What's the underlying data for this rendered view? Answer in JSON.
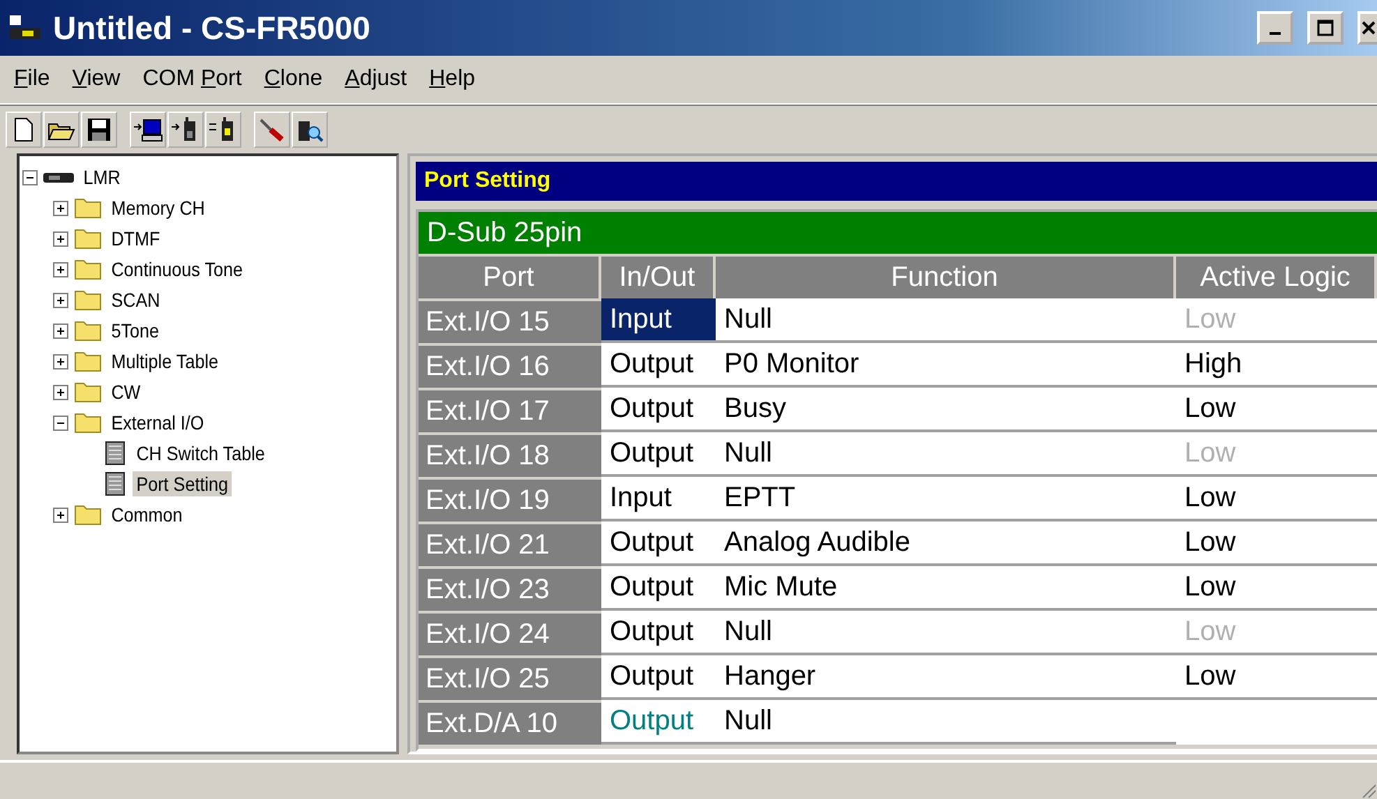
{
  "window": {
    "title": "Untitled - CS-FR5000"
  },
  "menu": [
    {
      "key": "F",
      "after": "ile"
    },
    {
      "key": "V",
      "after": "iew"
    },
    {
      "before": "COM ",
      "key": "P",
      "after": "ort"
    },
    {
      "key": "C",
      "after": "lone"
    },
    {
      "key": "A",
      "after": "djust"
    },
    {
      "key": "H",
      "after": "elp"
    }
  ],
  "toolbar": [
    {
      "kind": "new"
    },
    {
      "kind": "open"
    },
    {
      "kind": "save"
    },
    {
      "kind": "sep"
    },
    {
      "kind": "pc"
    },
    {
      "kind": "radio"
    },
    {
      "kind": "radio2"
    },
    {
      "kind": "sep"
    },
    {
      "kind": "tool"
    },
    {
      "kind": "find"
    }
  ],
  "tree": [
    {
      "label": "LMR",
      "kind": "device",
      "expanded": true,
      "selected": false,
      "children": [
        {
          "label": "Memory CH",
          "kind": "folder",
          "expanded": false,
          "selected": false
        },
        {
          "label": "DTMF",
          "kind": "folder",
          "expanded": false,
          "selected": false
        },
        {
          "label": "Continuous Tone",
          "kind": "folder",
          "expanded": false,
          "selected": false
        },
        {
          "label": "SCAN",
          "kind": "folder",
          "expanded": false,
          "selected": false
        },
        {
          "label": "5Tone",
          "kind": "folder",
          "expanded": false,
          "selected": false
        },
        {
          "label": "Multiple Table",
          "kind": "folder",
          "expanded": false,
          "selected": false
        },
        {
          "label": "CW",
          "kind": "folder",
          "expanded": false,
          "selected": false
        },
        {
          "label": "External I/O",
          "kind": "folder",
          "expanded": true,
          "selected": false,
          "children": [
            {
              "label": "CH Switch Table",
              "kind": "page",
              "selected": false
            },
            {
              "label": "Port Setting",
              "kind": "page",
              "selected": true
            }
          ]
        },
        {
          "label": "Common",
          "kind": "folder",
          "expanded": false,
          "selected": false
        }
      ]
    }
  ],
  "panel": {
    "title": "Port Setting",
    "group": "D-Sub 25pin",
    "columns": [
      "Port",
      "In/Out",
      "Function",
      "Active Logic"
    ],
    "rows": [
      {
        "port": "Ext.I/O 15",
        "in_out": "Input",
        "selected": true,
        "fixed": false,
        "function": "Null",
        "logic": "Low",
        "logic_disabled": true
      },
      {
        "port": "Ext.I/O 16",
        "in_out": "Output",
        "selected": false,
        "fixed": false,
        "function": "P0 Monitor",
        "logic": "High",
        "logic_disabled": false
      },
      {
        "port": "Ext.I/O 17",
        "in_out": "Output",
        "selected": false,
        "fixed": false,
        "function": "Busy",
        "logic": "Low",
        "logic_disabled": false
      },
      {
        "port": "Ext.I/O 18",
        "in_out": "Output",
        "selected": false,
        "fixed": false,
        "function": "Null",
        "logic": "Low",
        "logic_disabled": true
      },
      {
        "port": "Ext.I/O 19",
        "in_out": "Input",
        "selected": false,
        "fixed": false,
        "function": "EPTT",
        "logic": "Low",
        "logic_disabled": false
      },
      {
        "port": "Ext.I/O 21",
        "in_out": "Output",
        "selected": false,
        "fixed": false,
        "function": "Analog Audible",
        "logic": "Low",
        "logic_disabled": false
      },
      {
        "port": "Ext.I/O 23",
        "in_out": "Output",
        "selected": false,
        "fixed": false,
        "function": "Mic Mute",
        "logic": "Low",
        "logic_disabled": false
      },
      {
        "port": "Ext.I/O 24",
        "in_out": "Output",
        "selected": false,
        "fixed": false,
        "function": "Null",
        "logic": "Low",
        "logic_disabled": true
      },
      {
        "port": "Ext.I/O 25",
        "in_out": "Output",
        "selected": false,
        "fixed": false,
        "function": "Hanger",
        "logic": "Low",
        "logic_disabled": false
      },
      {
        "port": "Ext.D/A 10",
        "in_out": "Output",
        "selected": false,
        "fixed": true,
        "function": "Null"
      }
    ]
  }
}
